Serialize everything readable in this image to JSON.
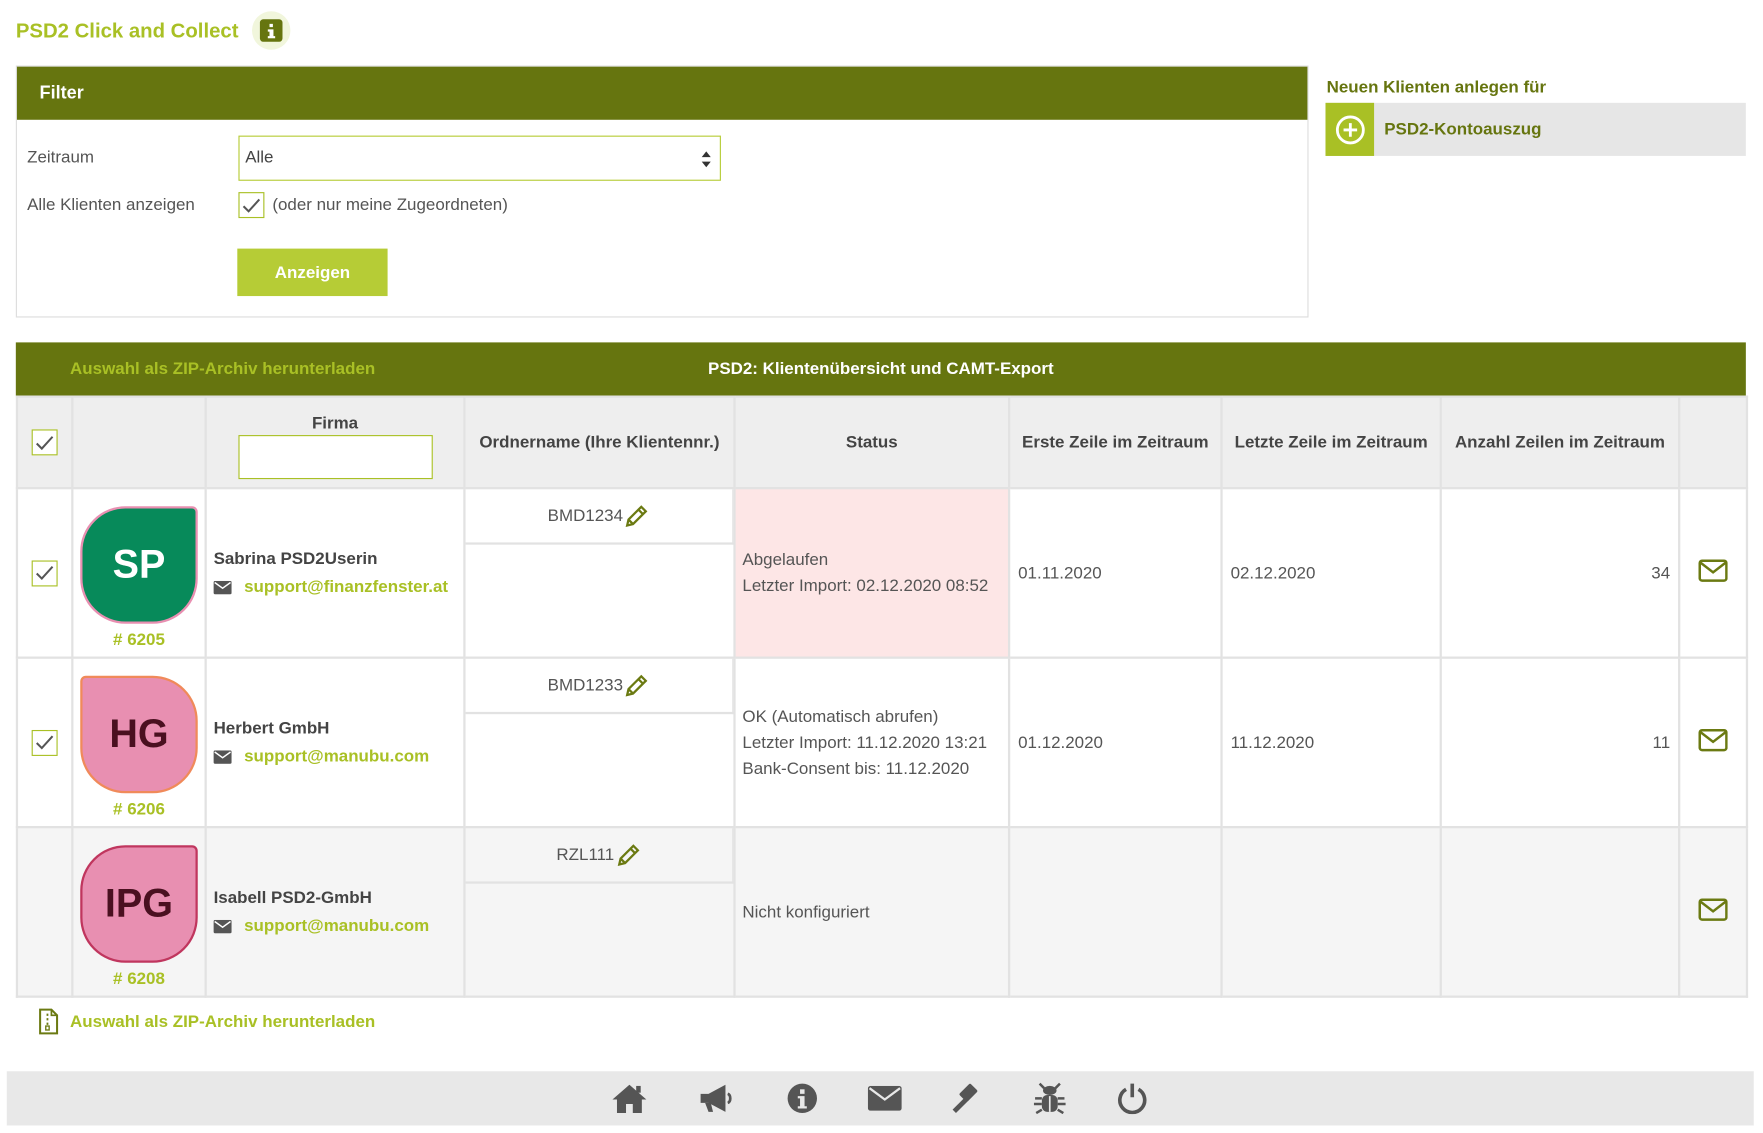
{
  "app": {
    "title": "PSD2 Click and Collect"
  },
  "filter": {
    "header": "Filter",
    "zeitraum_label": "Zeitraum",
    "zeitraum_value": "Alle",
    "alle_label": "Alle Klienten anzeigen",
    "alle_hint": "(oder nur meine Zugeordneten)",
    "alle_checked": true,
    "button": "Anzeigen"
  },
  "new_client": {
    "title": "Neuen Klienten anlegen für",
    "button": "PSD2-Kontoauszug"
  },
  "table": {
    "zip_link": "Auswahl als ZIP-Archiv herunterladen",
    "title": "PSD2: Klientenübersicht und CAMT-Export",
    "columns": {
      "firma": "Firma",
      "ordner": "Ordnername (Ihre Klientennr.)",
      "status": "Status",
      "erste": "Erste Zeile im Zeitraum",
      "letzte": "Letzte Zeile im Zeitraum",
      "anzahl": "Anzahl Zeilen im Zeitraum"
    },
    "rows": [
      {
        "checked": true,
        "initials": "SP",
        "number": "# 6205",
        "name": "Sabrina PSD2Userin",
        "email": "support@finanzfenster.at",
        "ordner": "BMD1234",
        "status": [
          "Abgelaufen",
          "Letzter Import: 02.12.2020 08:52"
        ],
        "erste": "01.11.2020",
        "letzte": "02.12.2020",
        "anzahl": "34"
      },
      {
        "checked": true,
        "initials": "HG",
        "number": "# 6206",
        "name": "Herbert GmbH",
        "email": "support@manubu.com",
        "ordner": "BMD1233",
        "status": [
          "OK (Automatisch abrufen)",
          "Letzter Import: 11.12.2020 13:21",
          "Bank-Consent bis: 11.12.2020"
        ],
        "erste": "01.12.2020",
        "letzte": "11.12.2020",
        "anzahl": "11"
      },
      {
        "checked": false,
        "initials": "IPG",
        "number": "# 6208",
        "name": "Isabell PSD2-GmbH",
        "email": "support@manubu.com",
        "ordner": "RZL111",
        "status": [
          "Nicht konfiguriert"
        ],
        "erste": "",
        "letzte": "",
        "anzahl": ""
      }
    ]
  },
  "footer_zip": "Auswahl als ZIP-Archiv herunterladen",
  "nav_icons": [
    "home-icon",
    "megaphone-icon",
    "info-icon",
    "envelope-icon",
    "gavel-icon",
    "bug-icon",
    "power-icon"
  ],
  "colors": {
    "olive": "#66750f",
    "lime": "#a9c025",
    "expired_bg": "#fde6e6",
    "sp_avatar": "#078a5a",
    "pink_avatar": "#e88fb1"
  }
}
